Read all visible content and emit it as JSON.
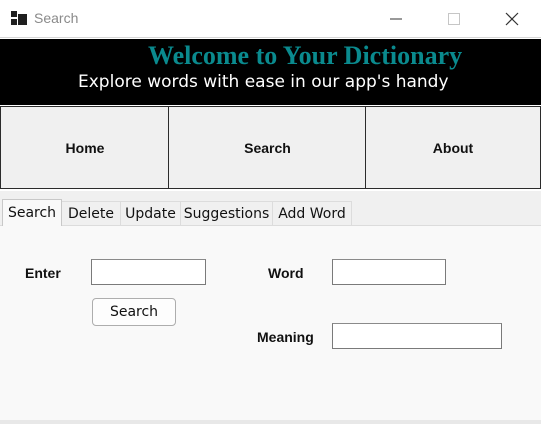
{
  "window": {
    "title": "Search",
    "icon": "app-window-icon"
  },
  "banner": {
    "title": "Welcome to Your Dictionary",
    "subtitle": "Explore words with ease in our app's handy",
    "title_color": "#0a8a8e",
    "background": "#000000"
  },
  "nav": {
    "home": "Home",
    "search": "Search",
    "about": "About"
  },
  "tabs": [
    {
      "label": "Search",
      "active": true
    },
    {
      "label": "Delete",
      "active": false
    },
    {
      "label": "Update",
      "active": false
    },
    {
      "label": "Suggestions",
      "active": false
    },
    {
      "label": "Add Word",
      "active": false
    }
  ],
  "search_tab": {
    "enter_label": "Enter",
    "enter_value": "",
    "search_button": "Search",
    "word_label": "Word",
    "word_value": "",
    "meaning_label": "Meaning",
    "meaning_value": ""
  }
}
